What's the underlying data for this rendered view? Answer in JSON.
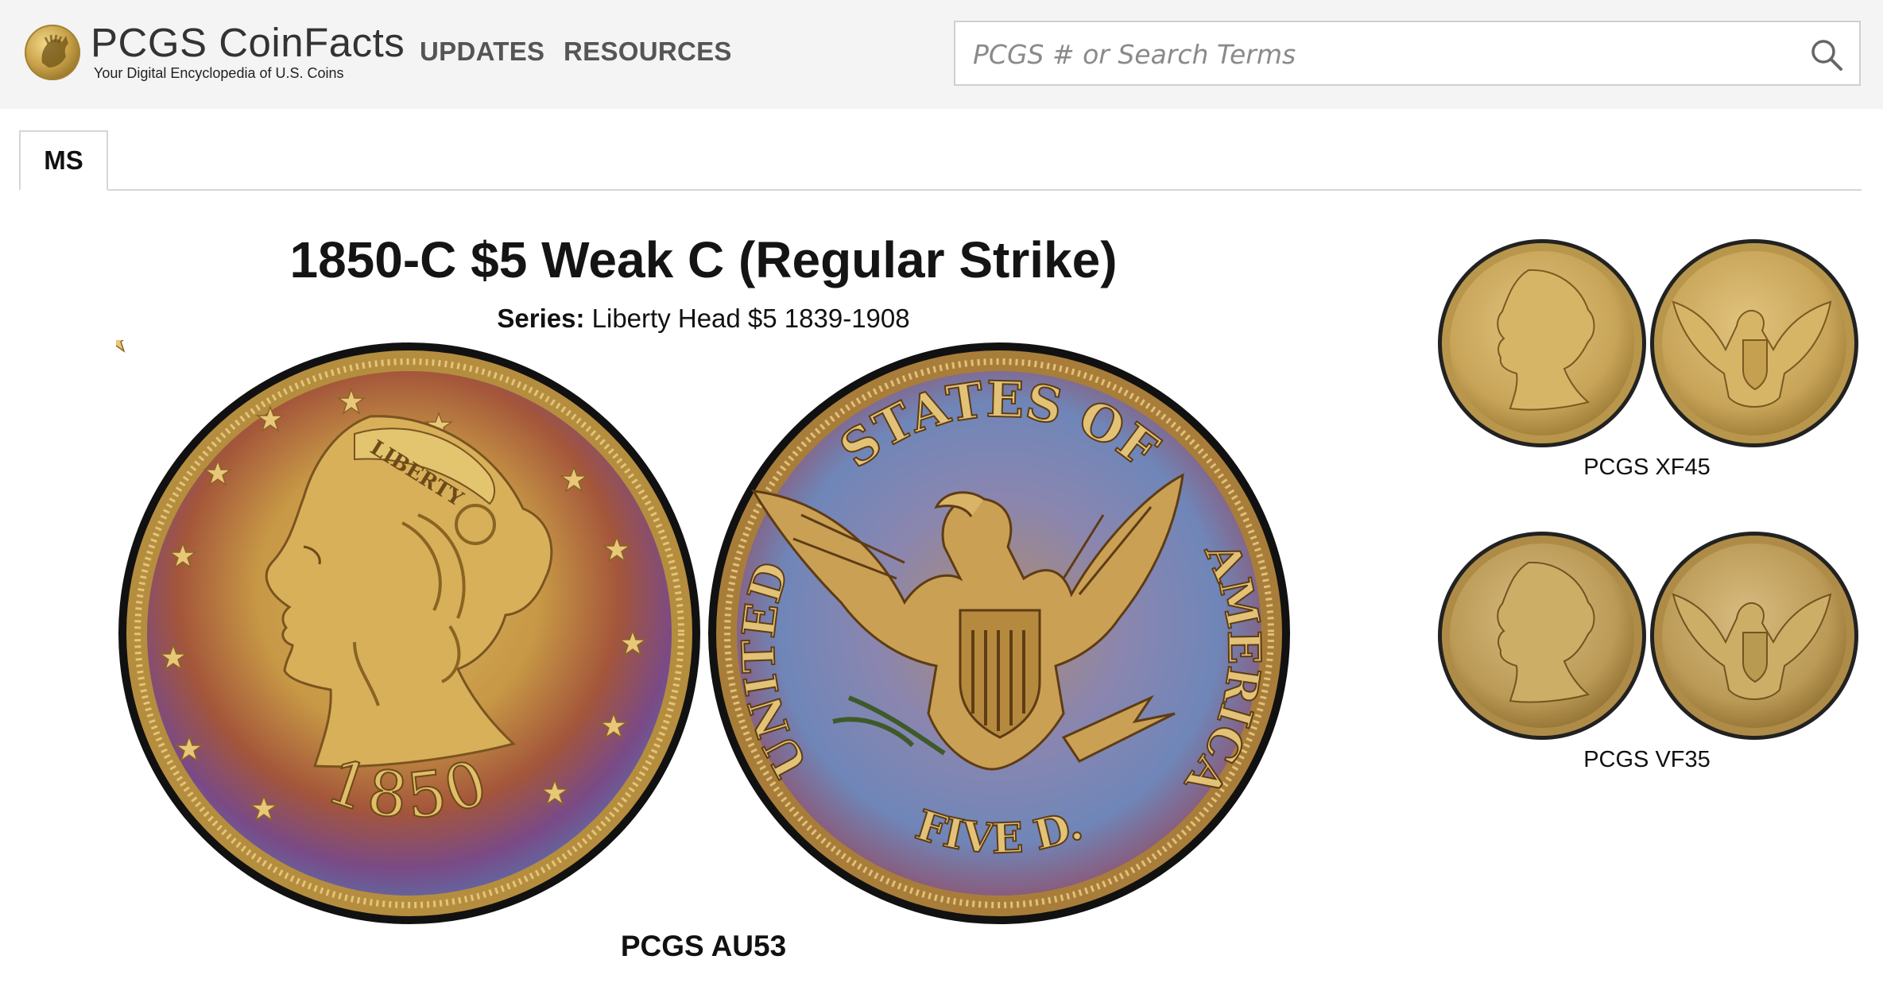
{
  "header": {
    "logo_title": "PCGS CoinFacts",
    "logo_subtitle": "Your Digital Encyclopedia of U.S. Coins",
    "nav": {
      "updates": "UPDATES",
      "resources": "RESOURCES"
    },
    "search_placeholder": "PCGS # or Search Terms"
  },
  "tabs": [
    {
      "label": "MS",
      "active": true
    }
  ],
  "coin": {
    "title": "1850-C $5 Weak C (Regular Strike)",
    "series_label": "Series:",
    "series_value": "Liberty Head $5 1839-1908",
    "obverse": {
      "date": "1850",
      "headband": "LIBERTY"
    },
    "reverse": {
      "legend_top": "STATES OF",
      "legend_left": "UNITED",
      "legend_right": "AMERICA",
      "denomination": "FIVE D."
    },
    "main_grade": "PCGS AU53"
  },
  "additional_images": [
    {
      "grade": "PCGS XF45"
    },
    {
      "grade": "PCGS VF35"
    }
  ],
  "colors": {
    "header_bg": "#f4f4f4",
    "gold": "#c9a24a",
    "tone_purple": "#7a4a8a",
    "tone_blue": "#6f86b8"
  }
}
